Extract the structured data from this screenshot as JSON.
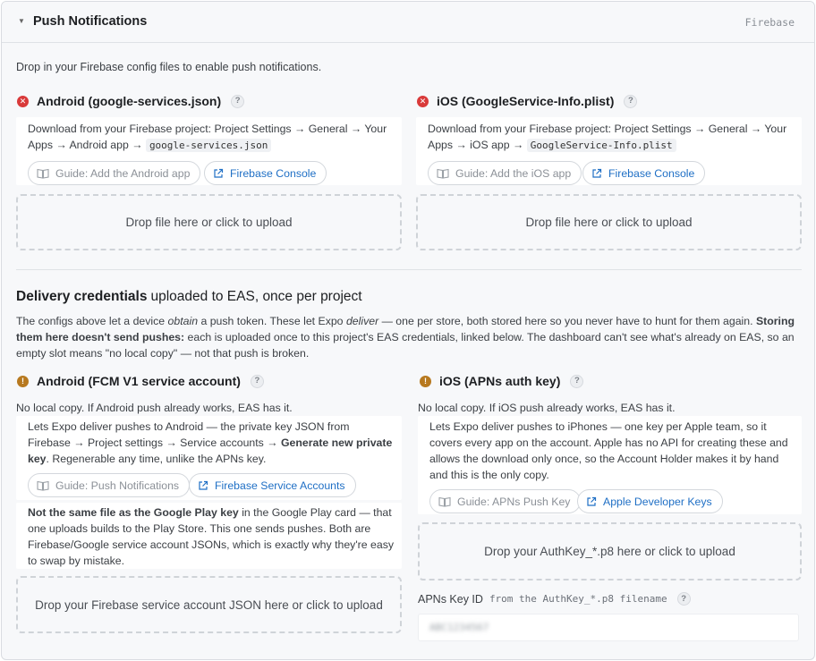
{
  "header": {
    "title": "Push Notifications",
    "tag": "Firebase"
  },
  "intro": "Drop in your Firebase config files to enable push notifications.",
  "android_config": {
    "title": "Android (google-services.json)",
    "desc_prefix": "Download from your Firebase project: Project Settings → General → Your Apps → Android app → ",
    "desc_code": "google-services.json",
    "guide_label": "Guide: Add the Android app",
    "console_label": "Firebase Console",
    "drop_label": "Drop file here or click to upload"
  },
  "ios_config": {
    "title": "iOS (GoogleService-Info.plist)",
    "desc_prefix": "Download from your Firebase project: Project Settings → General → Your Apps → iOS app → ",
    "desc_code": "GoogleService-Info.plist",
    "guide_label": "Guide: Add the iOS app",
    "console_label": "Firebase Console",
    "drop_label": "Drop file here or click to upload"
  },
  "delivery": {
    "title": "Delivery credentials",
    "subtitle": "uploaded to EAS, once per project",
    "body_1": "The configs above let a device ",
    "body_obtain": "obtain",
    "body_2": " a push token. These let Expo ",
    "body_deliver": "deliver",
    "body_3": " — one per store, both stored here so you never have to hunt for them again. ",
    "body_bold": "Storing them here doesn't send pushes:",
    "body_4": " each is uploaded once to this project's EAS credentials, linked below. The dashboard can't see what's already on EAS, so an empty slot means \"no local copy\" — not that push is broken."
  },
  "android_fcm": {
    "title": "Android (FCM V1 service account)",
    "no_local": "No local copy. If Android push already works, EAS has it.",
    "desc_1": "Lets Expo deliver pushes to Android — the private key JSON from Firebase → Project settings → Service accounts → ",
    "desc_bold": "Generate new private key",
    "desc_2": ". Regenerable any time, unlike the APNs key.",
    "guide_label": "Guide: Push Notifications",
    "console_label": "Firebase Service Accounts",
    "note_bold": "Not the same file as the Google Play key",
    "note_rest": " in the Google Play card — that one uploads builds to the Play Store. This one sends pushes. Both are Firebase/Google service account JSONs, which is exactly why they're easy to swap by mistake.",
    "drop_label": "Drop your Firebase service account JSON here or click to upload"
  },
  "ios_apns": {
    "title": "iOS (APNs auth key)",
    "no_local": "No local copy. If iOS push already works, EAS has it.",
    "desc": "Lets Expo deliver pushes to iPhones — one key per Apple team, so it covers every app on the account. Apple has no API for creating these and allows the download only once, so the Account Holder makes it by hand and this is the only copy.",
    "guide_label": "Guide: APNs Push Key",
    "console_label": "Apple Developer Keys",
    "drop_label": "Drop your AuthKey_*.p8 here or click to upload",
    "key_label": "APNs Key ID",
    "key_hint": "from the AuthKey_*.p8 filename",
    "key_value": "ABC1234567"
  },
  "icons": {
    "help": "?",
    "error": "✕",
    "warning": "!"
  },
  "colors": {
    "error": "#d93a3a",
    "warning": "#b7791f",
    "link": "#1f6fc5"
  }
}
